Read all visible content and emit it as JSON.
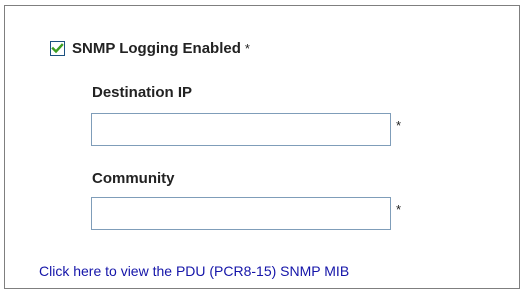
{
  "snmp_logging": {
    "label": "SNMP Logging Enabled",
    "required_marker": "*",
    "checked": true
  },
  "destination_ip": {
    "label": "Destination IP",
    "value": "",
    "required_marker": "*"
  },
  "community": {
    "label": "Community",
    "value": "",
    "required_marker": "*"
  },
  "mib_link": {
    "text": "Click here to view the PDU (PCR8-15) SNMP MIB"
  },
  "colors": {
    "checkmark": "#3c9e21",
    "checkbox_border": "#1c5180",
    "input_border": "#7f9db9",
    "link": "#1515a9",
    "panel_border": "#7f7f7f"
  },
  "icons": {
    "checkbox_mark": "checkmark-icon"
  }
}
